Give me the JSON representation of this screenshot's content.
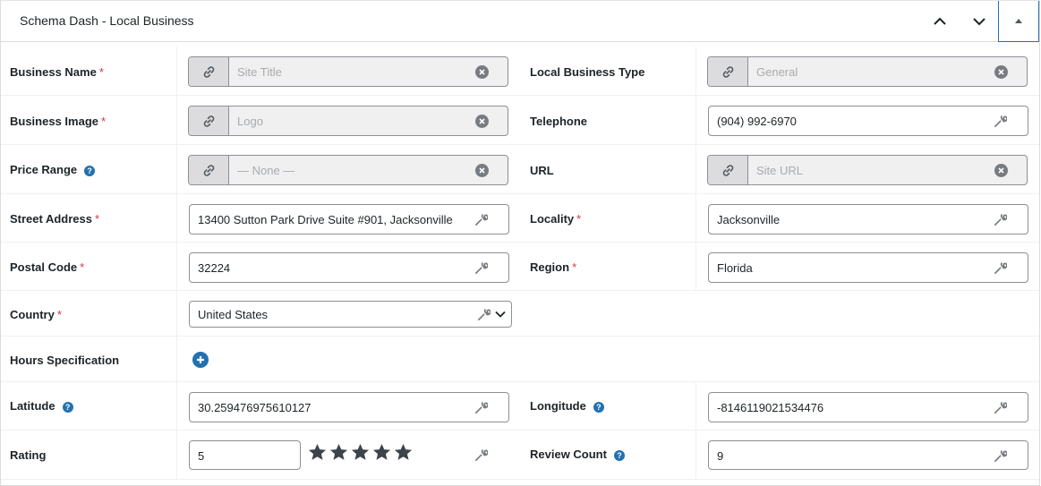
{
  "header": {
    "title": "Schema Dash - Local Business",
    "move_up_icon": "chevron-up-icon",
    "move_down_icon": "chevron-down-icon",
    "toggle_icon": "triangle-up-icon"
  },
  "required_mark": "*",
  "help_mark": "?",
  "fields": {
    "business_name": {
      "label": "Business Name",
      "placeholder": "Site Title"
    },
    "local_business_type": {
      "label": "Local Business Type",
      "placeholder": "General"
    },
    "business_image": {
      "label": "Business Image",
      "placeholder": "Logo"
    },
    "telephone": {
      "label": "Telephone",
      "value": "(904) 992-6970"
    },
    "price_range": {
      "label": "Price Range",
      "placeholder": "— None —"
    },
    "url": {
      "label": "URL",
      "placeholder": "Site URL"
    },
    "street_address": {
      "label": "Street Address",
      "value": "13400 Sutton Park Drive Suite #901, Jacksonville"
    },
    "locality": {
      "label": "Locality",
      "value": "Jacksonville"
    },
    "postal_code": {
      "label": "Postal Code",
      "value": "32224"
    },
    "region": {
      "label": "Region",
      "value": "Florida"
    },
    "country": {
      "label": "Country",
      "value": "United States"
    },
    "hours_specification": {
      "label": "Hours Specification"
    },
    "latitude": {
      "label": "Latitude",
      "value": "30.259476975610127"
    },
    "longitude": {
      "label": "Longitude",
      "value": "-8146119021534476"
    },
    "rating": {
      "label": "Rating",
      "value": "5",
      "stars_filled": 5,
      "stars_total": 5
    },
    "review_count": {
      "label": "Review Count",
      "value": "9"
    }
  },
  "colors": {
    "accent": "#2271b1",
    "required": "#d63638",
    "border": "#8c8f94",
    "placeholder": "#a7aaad",
    "icon": "#787c82",
    "star": "#3c434a"
  }
}
